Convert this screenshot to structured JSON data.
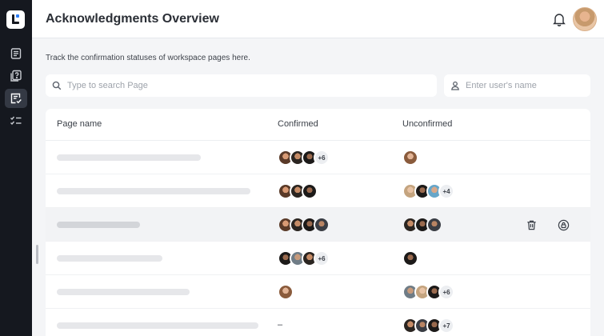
{
  "header": {
    "title": "Acknowledgments Overview"
  },
  "subtitle": "Track the confirmation statuses of workspace pages here.",
  "search": {
    "page_placeholder": "Type to search Page",
    "user_placeholder": "Enter user's name"
  },
  "table": {
    "columns": [
      "Page name",
      "Confirmed",
      "Unconfirmed"
    ],
    "rows": [
      {
        "confirmed_more": "+6",
        "unconfirmed_more": ""
      },
      {
        "confirmed_more": "",
        "unconfirmed_more": "+4"
      },
      {
        "confirmed_more": "",
        "unconfirmed_more": ""
      },
      {
        "confirmed_more": "+6",
        "unconfirmed_more": ""
      },
      {
        "confirmed_more": "",
        "unconfirmed_more": "+6"
      },
      {
        "confirmed_empty": "–",
        "confirmed_more": "",
        "unconfirmed_more": "+7"
      }
    ]
  },
  "icons": {
    "sidebar": [
      "logo-icon",
      "document-icon",
      "question-page-icon",
      "acknowledgment-icon",
      "checklist-icon"
    ],
    "header": [
      "bell-icon",
      "avatar"
    ],
    "row_actions": [
      "trash-icon",
      "lock-icon"
    ]
  },
  "colors": {
    "sidebar_bg": "#15181f",
    "sidebar_active": "#343944",
    "page_bg": "#f4f5f7",
    "card_bg": "#ffffff",
    "highlight_row": "#f2f3f5",
    "brand_accent": "#2d7ef7"
  }
}
